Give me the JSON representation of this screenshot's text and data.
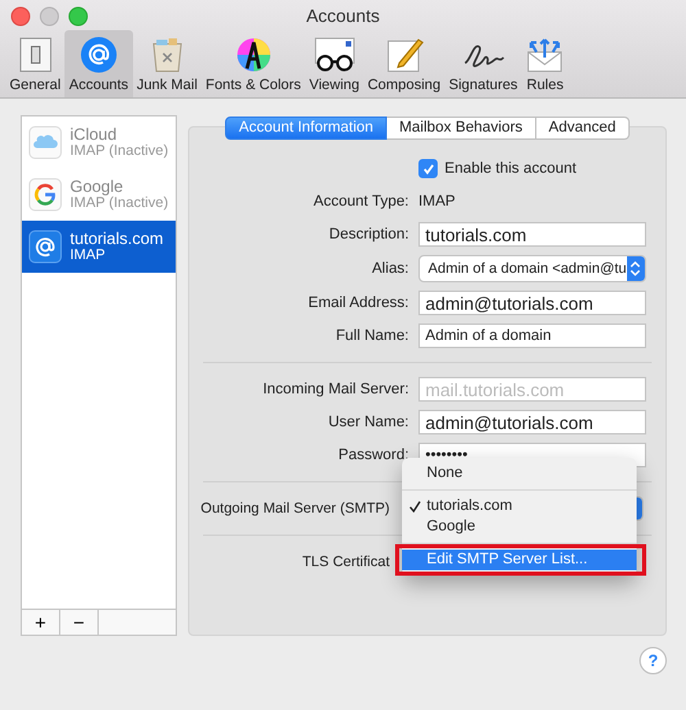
{
  "window": {
    "title": "Accounts"
  },
  "toolbar": [
    {
      "label": "General",
      "selected": false
    },
    {
      "label": "Accounts",
      "selected": true
    },
    {
      "label": "Junk Mail",
      "selected": false
    },
    {
      "label": "Fonts & Colors",
      "selected": false
    },
    {
      "label": "Viewing",
      "selected": false
    },
    {
      "label": "Composing",
      "selected": false
    },
    {
      "label": "Signatures",
      "selected": false
    },
    {
      "label": "Rules",
      "selected": false
    }
  ],
  "accounts": [
    {
      "name": "iCloud",
      "status": "IMAP (Inactive)",
      "selected": false
    },
    {
      "name": "Google",
      "status": "IMAP (Inactive)",
      "selected": false
    },
    {
      "name": "tutorials.com",
      "status": "IMAP",
      "selected": true
    }
  ],
  "account_buttons": [
    "+",
    "−"
  ],
  "tabs": [
    {
      "label": "Account Information",
      "selected": true
    },
    {
      "label": "Mailbox Behaviors",
      "selected": false
    },
    {
      "label": "Advanced",
      "selected": false
    }
  ],
  "form": [
    {
      "kind": "checkbox",
      "label": "Enable this account",
      "checked": true
    },
    {
      "kind": "text",
      "label": "Account Type:",
      "value": "IMAP"
    },
    {
      "kind": "input",
      "label": "Description:",
      "value": "tutorials.com",
      "large": true
    },
    {
      "kind": "select",
      "label": "Alias:",
      "value": "Admin of a domain <admin@tu"
    },
    {
      "kind": "input",
      "label": "Email Address:",
      "value": "admin@tutorials.com",
      "large": true
    },
    {
      "kind": "input",
      "label": "Full Name:",
      "value": "Admin of a domain",
      "large": false
    },
    {
      "kind": "divider"
    },
    {
      "kind": "input",
      "label": "Incoming Mail Server:",
      "placeholder": "mail.tutorials.com",
      "large": true
    },
    {
      "kind": "input",
      "label": "User Name:",
      "value": "admin@tutorials.com",
      "large": true
    },
    {
      "kind": "input",
      "label": "Password:",
      "value": "••••••••",
      "large": false
    },
    {
      "kind": "divider"
    },
    {
      "kind": "popup",
      "label": "Outgoing Mail Server (SMTP)"
    },
    {
      "kind": "divider"
    },
    {
      "kind": "label",
      "label": "TLS Certificat"
    }
  ],
  "smtp_menu": [
    {
      "kind": "item",
      "label": "None",
      "checked": false,
      "selected": false,
      "highlighted": false
    },
    {
      "kind": "separator"
    },
    {
      "kind": "item",
      "label": "tutorials.com",
      "checked": true,
      "selected": false,
      "highlighted": false
    },
    {
      "kind": "item",
      "label": "Google",
      "checked": false,
      "selected": false,
      "highlighted": false
    },
    {
      "kind": "separator"
    },
    {
      "kind": "item",
      "label": "Edit SMTP Server List...",
      "checked": false,
      "selected": true,
      "highlighted": true
    }
  ],
  "help_button": "?"
}
